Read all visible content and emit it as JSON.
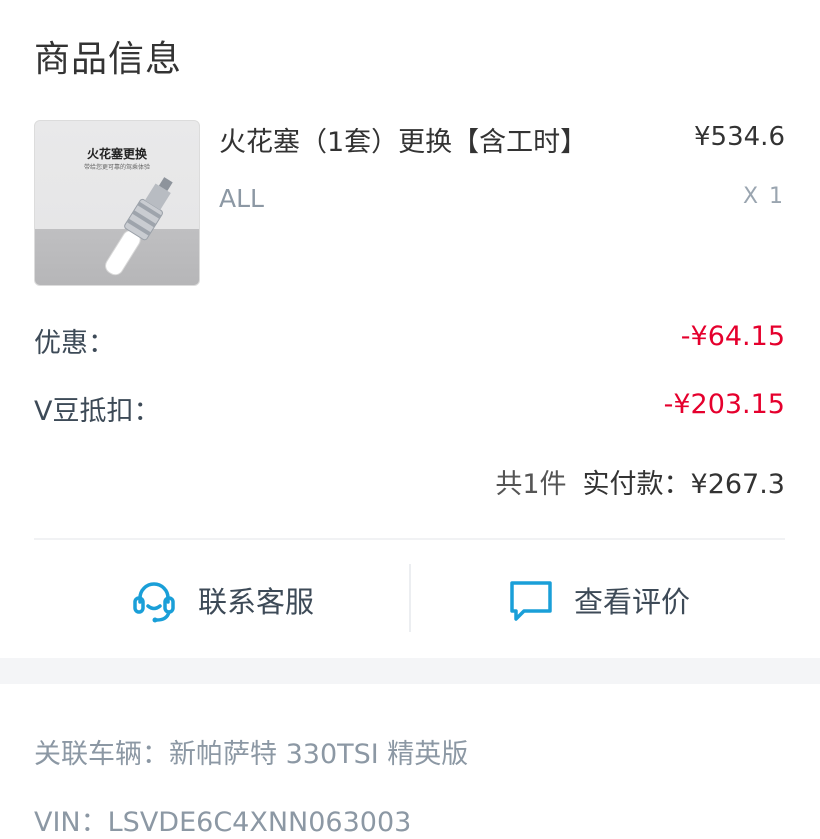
{
  "section": {
    "title": "商品信息"
  },
  "product": {
    "image_title": "火花塞更换",
    "image_subtitle": "带给您更可靠的驾乘体验",
    "name": "火花塞（1套）更换【含工时】",
    "price": "¥534.6",
    "spec": "ALL",
    "quantity": "X 1"
  },
  "discount": {
    "label": "优惠：",
    "value": "-¥64.15"
  },
  "vbean": {
    "label": "V豆抵扣：",
    "value": "-¥203.15"
  },
  "total": {
    "count_text": "共1件",
    "paid_label": "实付款：",
    "paid_value": "¥267.3"
  },
  "actions": {
    "service_label": "联系客服",
    "review_label": "查看评价",
    "service_icon": "headset-icon",
    "review_icon": "chat-bubble-icon",
    "icon_color": "#1a9fd8"
  },
  "vehicle": {
    "label": "关联车辆：",
    "value": "新帕萨特 330TSI 精英版",
    "vin_label": "VIN：",
    "vin_value": "LSVDE6C4XNN063003"
  }
}
